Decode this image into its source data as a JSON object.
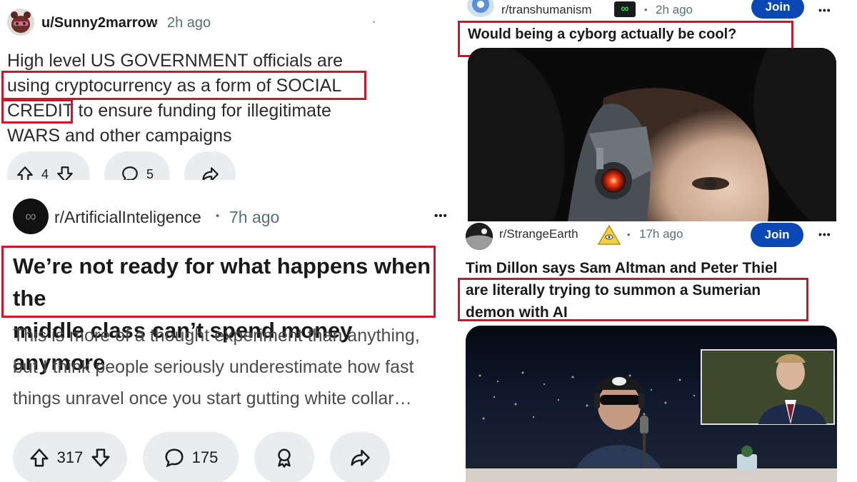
{
  "post1": {
    "author": "u/Sunny2marrow",
    "dot": "•",
    "time": "2h ago",
    "title_lines": [
      "High level US GOVERNMENT officials are",
      "using cryptocurrency as a form of SOCIAL",
      "CREDIT",
      " to ensure funding for illegitimate",
      "WARS and other campaigns"
    ],
    "upvotes": "4",
    "comments": "5"
  },
  "post2": {
    "subreddit": "r/ArtificialInteligence",
    "dot": "•",
    "time": "7h ago",
    "menu": "•••",
    "title_lines": [
      "We’re not ready for what happens when the",
      "middle class can’t spend money anymore"
    ],
    "body_lines": [
      "This is more of a thought experiment than anything,",
      "but I think people seriously underestimate how fast",
      "things unravel once you start gutting white collar…"
    ],
    "upvotes": "317",
    "comments": "175"
  },
  "post3": {
    "subreddit": "r/transhumanism",
    "dot": "•",
    "time": "2h ago",
    "join": "Join",
    "menu": "•••",
    "title": "Would being a cyborg actually be cool?"
  },
  "post4": {
    "subreddit": "r/StrangeEarth",
    "dot": "•",
    "time": "17h ago",
    "join": "Join",
    "menu": "•••",
    "title_lines": [
      "Tim Dillon says Sam Altman and Peter Thiel",
      "are literally trying to summon a Sumerian",
      "demon with AI"
    ]
  },
  "colors": {
    "highlight_box": "#d0142c",
    "join_button": "#0a49b5",
    "pill_bg": "#eaedef"
  }
}
